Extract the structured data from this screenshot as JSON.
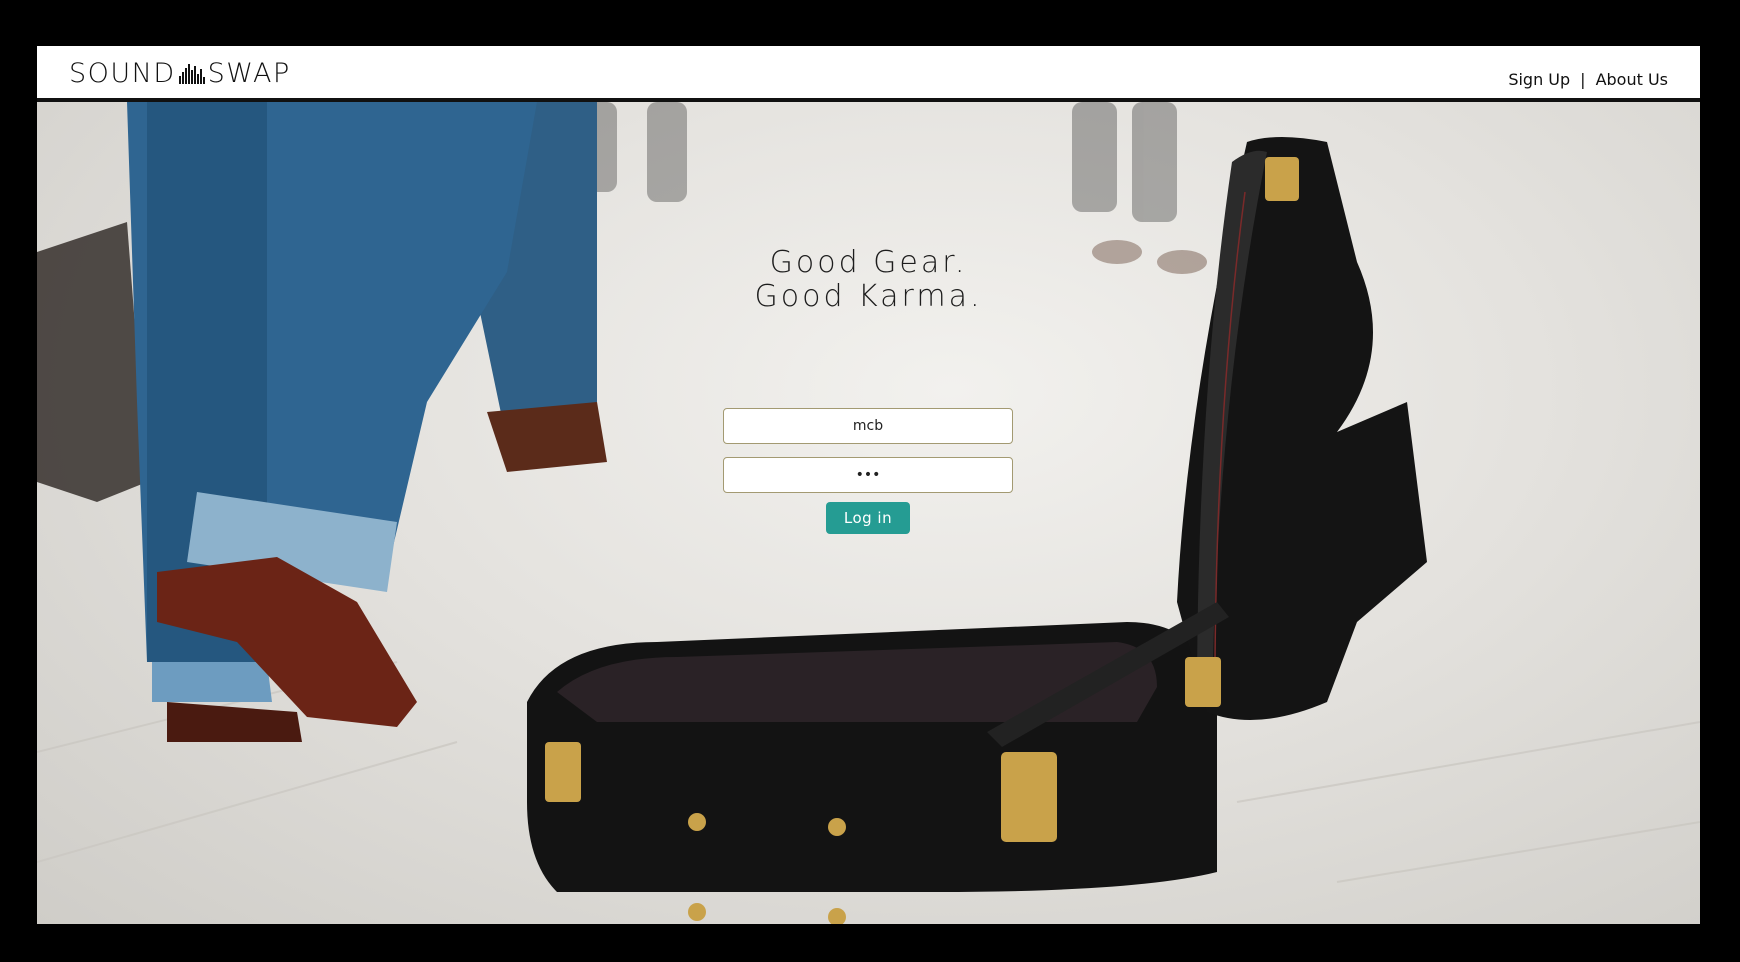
{
  "header": {
    "logo_left": "SOUND",
    "logo_right": "SWAP",
    "nav": {
      "signup_label": "Sign Up",
      "separator": "|",
      "about_label": "About Us"
    }
  },
  "hero": {
    "tagline_line1": "Good Gear.",
    "tagline_line2": "Good Karma."
  },
  "login": {
    "username_value": "mcb",
    "password_value": "•••",
    "submit_label": "Log in"
  },
  "colors": {
    "accent": "#259c93",
    "field_border": "#a39a72",
    "header_bg": "#ffffff"
  }
}
